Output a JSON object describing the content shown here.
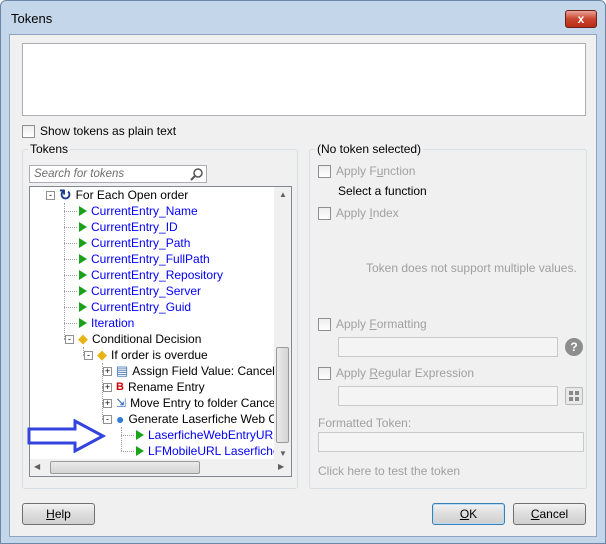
{
  "window": {
    "title": "Tokens",
    "close_label": "x"
  },
  "show_plain": {
    "label": "Show tokens as plain text"
  },
  "tokens_panel": {
    "title": "Tokens",
    "search_placeholder": "Search for tokens",
    "nodes": [
      {
        "label": "For Each Open order",
        "level": 0,
        "kind": "foreach",
        "blue": false,
        "expander": "-"
      },
      {
        "label": "CurrentEntry_Name",
        "level": 1,
        "kind": "token",
        "blue": true
      },
      {
        "label": "CurrentEntry_ID",
        "level": 1,
        "kind": "token",
        "blue": true
      },
      {
        "label": "CurrentEntry_Path",
        "level": 1,
        "kind": "token",
        "blue": true
      },
      {
        "label": "CurrentEntry_FullPath",
        "level": 1,
        "kind": "token",
        "blue": true
      },
      {
        "label": "CurrentEntry_Repository",
        "level": 1,
        "kind": "token",
        "blue": true
      },
      {
        "label": "CurrentEntry_Server",
        "level": 1,
        "kind": "token",
        "blue": true
      },
      {
        "label": "CurrentEntry_Guid",
        "level": 1,
        "kind": "token",
        "blue": true
      },
      {
        "label": "Iteration",
        "level": 1,
        "kind": "token",
        "blue": true
      },
      {
        "label": "Conditional Decision",
        "level": 1,
        "kind": "decision",
        "blue": false,
        "expander": "-"
      },
      {
        "label": "If order is overdue",
        "level": 2,
        "kind": "decision",
        "blue": false,
        "expander": "-"
      },
      {
        "label": "Assign Field Value: Cancelled",
        "level": 3,
        "kind": "assign",
        "blue": false,
        "expander": "+"
      },
      {
        "label": "Rename Entry",
        "level": 3,
        "kind": "rename",
        "blue": false,
        "expander": "+"
      },
      {
        "label": "Move Entry to folder Cancelled",
        "level": 3,
        "kind": "move",
        "blue": false,
        "expander": "+"
      },
      {
        "label": "Generate Laserfiche Web Client",
        "level": 3,
        "kind": "globe",
        "blue": false,
        "expander": "-"
      },
      {
        "label": "LaserficheWebEntryURL T",
        "level": 4,
        "kind": "token",
        "blue": true
      },
      {
        "label": "LFMobileURL LaserficheW",
        "level": 4,
        "kind": "token",
        "blue": true
      }
    ]
  },
  "details": {
    "title": "(No token selected)",
    "apply_function": {
      "label": "Apply Function",
      "accel": "u",
      "pre": "Apply F",
      "post": "nction"
    },
    "select_function": "Select a function",
    "apply_index": {
      "pre": "Apply ",
      "accel": "I",
      "post": "ndex"
    },
    "multi_msg": "Token does not support multiple values.",
    "apply_formatting": {
      "pre": "Apply ",
      "accel": "F",
      "post": "ormatting"
    },
    "apply_regex": {
      "pre": "Apply ",
      "accel": "R",
      "post": "egular Expression"
    },
    "formatted_label": "Formatted Token:",
    "test_hint": "Click here to test the token",
    "help_glyph": "?"
  },
  "buttons": {
    "help": {
      "accel": "H",
      "rest": "elp"
    },
    "ok": {
      "accel": "O",
      "rest": "K"
    },
    "cancel": {
      "accel": "C",
      "rest": "ancel"
    }
  },
  "colors": {
    "token_blue": "#0000ff",
    "arrow_blue": "#3344dd",
    "title_bar": "#c4d6ea"
  }
}
